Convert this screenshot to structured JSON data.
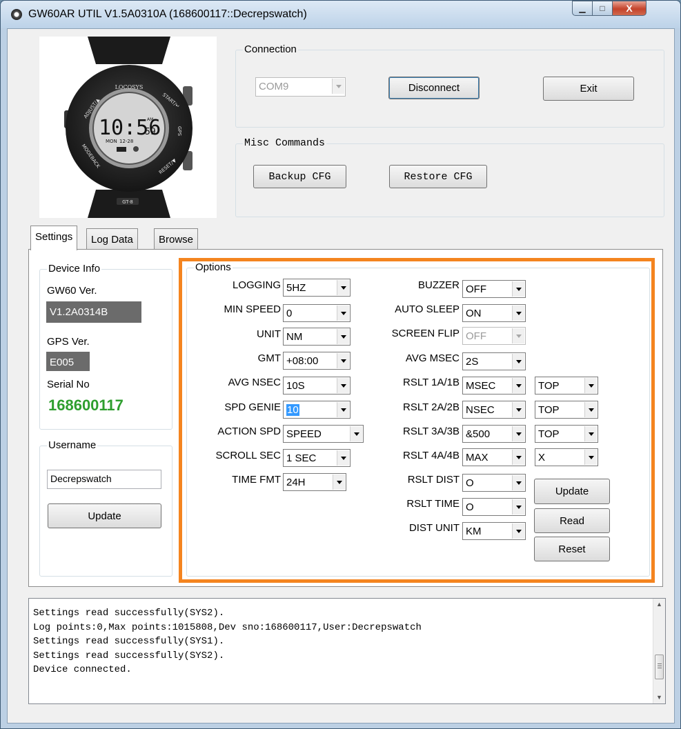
{
  "window": {
    "title": "GW60AR UTIL V1.5A0310A (168600117::Decrepswatch)",
    "min_glyph": "▁",
    "max_glyph": "□",
    "close_glyph": "X"
  },
  "watch": {
    "brand": "LOCOSYS",
    "time": "10:56",
    "seconds": "59",
    "day": "MON",
    "date": "12-28",
    "am": "AM",
    "bezel_top_right": "START/↵",
    "bezel_top_left": "ADJUST/▲",
    "bezel_bottom_left": "MODEBACK",
    "bezel_bottom_right": "RESET/▼",
    "side_right": "GPS",
    "bottom_logo": "GT-8"
  },
  "connection": {
    "label": "Connection",
    "port": "COM9",
    "disconnect": "Disconnect",
    "exit": "Exit"
  },
  "misc": {
    "label": "Misc Commands",
    "backup": "Backup CFG",
    "restore": "Restore CFG"
  },
  "tabs": [
    "Settings",
    "Log Data",
    "Browse"
  ],
  "device_info": {
    "label": "Device Info",
    "gw60_label": "GW60 Ver.",
    "gw60_value": "V1.2A0314B",
    "gps_label": "GPS Ver.",
    "gps_value": "E005",
    "serial_label": "Serial No",
    "serial_value": "168600117"
  },
  "username": {
    "label": "Username",
    "value": "Decrepswatch",
    "update": "Update"
  },
  "options": {
    "label": "Options",
    "left": [
      {
        "label": "LOGGING",
        "value": "5HZ"
      },
      {
        "label": "MIN SPEED",
        "value": "0"
      },
      {
        "label": "UNIT",
        "value": "NM"
      },
      {
        "label": "GMT",
        "value": "+08:00"
      },
      {
        "label": "AVG NSEC",
        "value": "10S"
      },
      {
        "label": "SPD GENIE",
        "value": "10"
      },
      {
        "label": "ACTION SPD",
        "value": "SPEED"
      },
      {
        "label": "SCROLL SEC",
        "value": "1 SEC"
      },
      {
        "label": "TIME FMT",
        "value": "24H"
      }
    ],
    "right": [
      {
        "label": "BUZZER",
        "value": "OFF"
      },
      {
        "label": "AUTO SLEEP",
        "value": "ON"
      },
      {
        "label": "SCREEN FLIP",
        "value": "OFF"
      },
      {
        "label": "AVG MSEC",
        "value": "2S"
      },
      {
        "label": "RSLT 1A/1B",
        "value": "MSEC",
        "value2": "TOP"
      },
      {
        "label": "RSLT 2A/2B",
        "value": "NSEC",
        "value2": "TOP"
      },
      {
        "label": "RSLT 3A/3B",
        "value": "&500",
        "value2": "TOP"
      },
      {
        "label": "RSLT 4A/4B",
        "value": "MAX",
        "value2": "X"
      },
      {
        "label": "RSLT DIST",
        "value": "O"
      },
      {
        "label": "RSLT TIME",
        "value": "O"
      },
      {
        "label": "DIST UNIT",
        "value": "KM"
      }
    ],
    "update": "Update",
    "read": "Read",
    "reset": "Reset"
  },
  "log": {
    "lines": "Settings read successfully(SYS2).\nLog points:0,Max points:1015808,Dev sno:168600117,User:Decrepswatch\nSettings read successfully(SYS1).\nSettings read successfully(SYS2).\nDevice connected."
  },
  "colors": {
    "highlight": "#f4841f",
    "serial": "#2e9e2e",
    "selection": "#3399ff"
  }
}
